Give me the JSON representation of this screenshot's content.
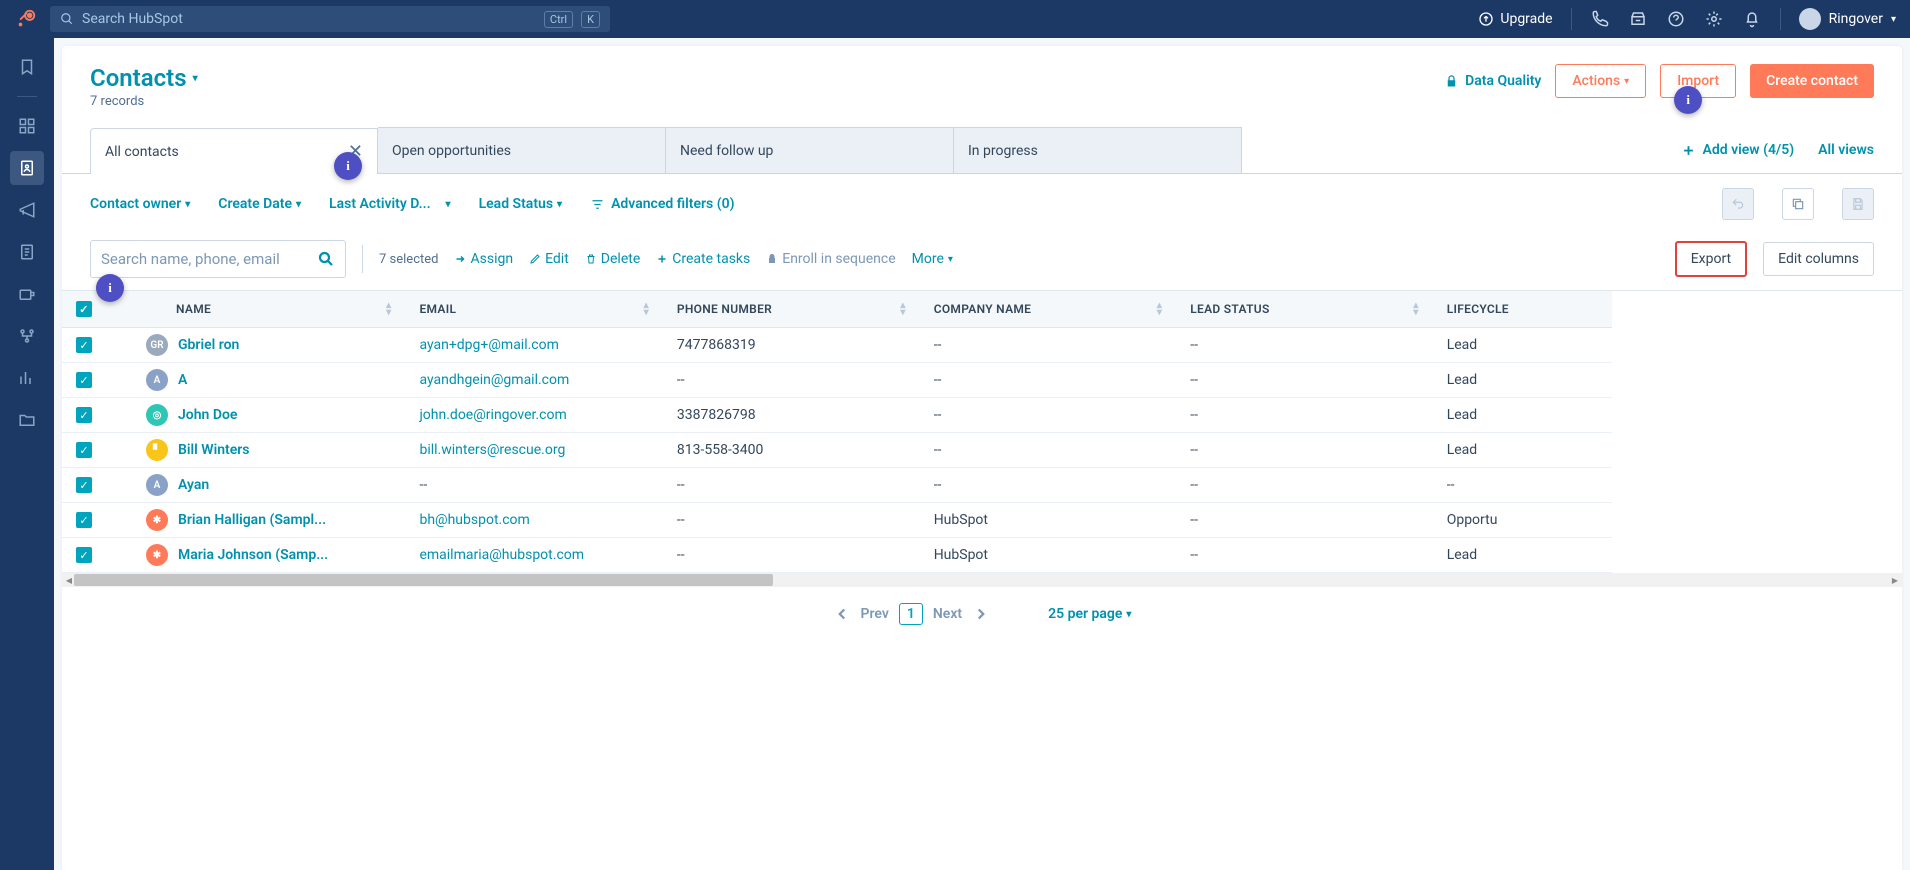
{
  "topnav": {
    "search_placeholder": "Search HubSpot",
    "kbd1": "Ctrl",
    "kbd2": "K",
    "upgrade": "Upgrade",
    "account": "Ringover"
  },
  "header": {
    "title": "Contacts",
    "subtitle": "7 records",
    "data_quality": "Data Quality",
    "actions": "Actions",
    "import": "Import",
    "create": "Create contact"
  },
  "tabs": [
    {
      "label": "All contacts",
      "closable": true,
      "active": true
    },
    {
      "label": "Open opportunities",
      "closable": false,
      "active": false
    },
    {
      "label": "Need follow up",
      "closable": false,
      "active": false
    },
    {
      "label": "In progress",
      "closable": false,
      "active": false
    }
  ],
  "tabs_right": {
    "add_view": "Add view (4/5)",
    "all_views": "All views"
  },
  "filters": {
    "owner": "Contact owner",
    "create": "Create Date",
    "activity": "Last Activity D...",
    "lead": "Lead Status",
    "advanced": "Advanced filters (0)"
  },
  "toolbar": {
    "search_placeholder": "Search name, phone, email",
    "selected": "7 selected",
    "assign": "Assign",
    "edit": "Edit",
    "delete": "Delete",
    "create_tasks": "Create tasks",
    "enroll": "Enroll in sequence",
    "more": "More",
    "export": "Export",
    "edit_columns": "Edit columns"
  },
  "columns": {
    "name": "NAME",
    "email": "EMAIL",
    "phone": "PHONE NUMBER",
    "company": "COMPANY NAME",
    "lead": "LEAD STATUS",
    "lifecycle": "LIFECYCLE"
  },
  "rows": [
    {
      "avatar": {
        "text": "GR",
        "bg": "#9aa9bb"
      },
      "name": "Gbriel ron",
      "email": "ayan+dpg+@mail.com",
      "phone": "7477868319",
      "company": "--",
      "lead": "--",
      "lc": "Lead"
    },
    {
      "avatar": {
        "text": "A",
        "bg": "#8aa2c8"
      },
      "name": "A",
      "email": "ayandhgein@gmail.com",
      "phone": "--",
      "company": "--",
      "lead": "--",
      "lc": "Lead"
    },
    {
      "avatar": {
        "text": "◎",
        "bg": "#2ec7b6"
      },
      "name": "John Doe",
      "email": "john.doe@ringover.com",
      "phone": "3387826798",
      "company": "--",
      "lead": "--",
      "lc": "Lead"
    },
    {
      "avatar": {
        "text": "▘",
        "bg": "#f9c518"
      },
      "name": "Bill Winters",
      "email": "bill.winters@rescue.org",
      "phone": "813-558-3400",
      "company": "--",
      "lead": "--",
      "lc": "Lead"
    },
    {
      "avatar": {
        "text": "A",
        "bg": "#8aa2c8"
      },
      "name": "Ayan",
      "email": "--",
      "phone": "--",
      "company": "--",
      "lead": "--",
      "lc": "--"
    },
    {
      "avatar": {
        "text": "✱",
        "bg": "#ff7a59"
      },
      "name": "Brian Halligan (Sampl...",
      "email": "bh@hubspot.com",
      "phone": "--",
      "company": "HubSpot",
      "lead": "--",
      "lc": "Opportu"
    },
    {
      "avatar": {
        "text": "✱",
        "bg": "#ff7a59"
      },
      "name": "Maria Johnson (Samp...",
      "email": "emailmaria@hubspot.com",
      "phone": "--",
      "company": "HubSpot",
      "lead": "--",
      "lc": "Lead"
    }
  ],
  "pager": {
    "prev": "Prev",
    "page": "1",
    "next": "Next",
    "per_page": "25 per page"
  }
}
